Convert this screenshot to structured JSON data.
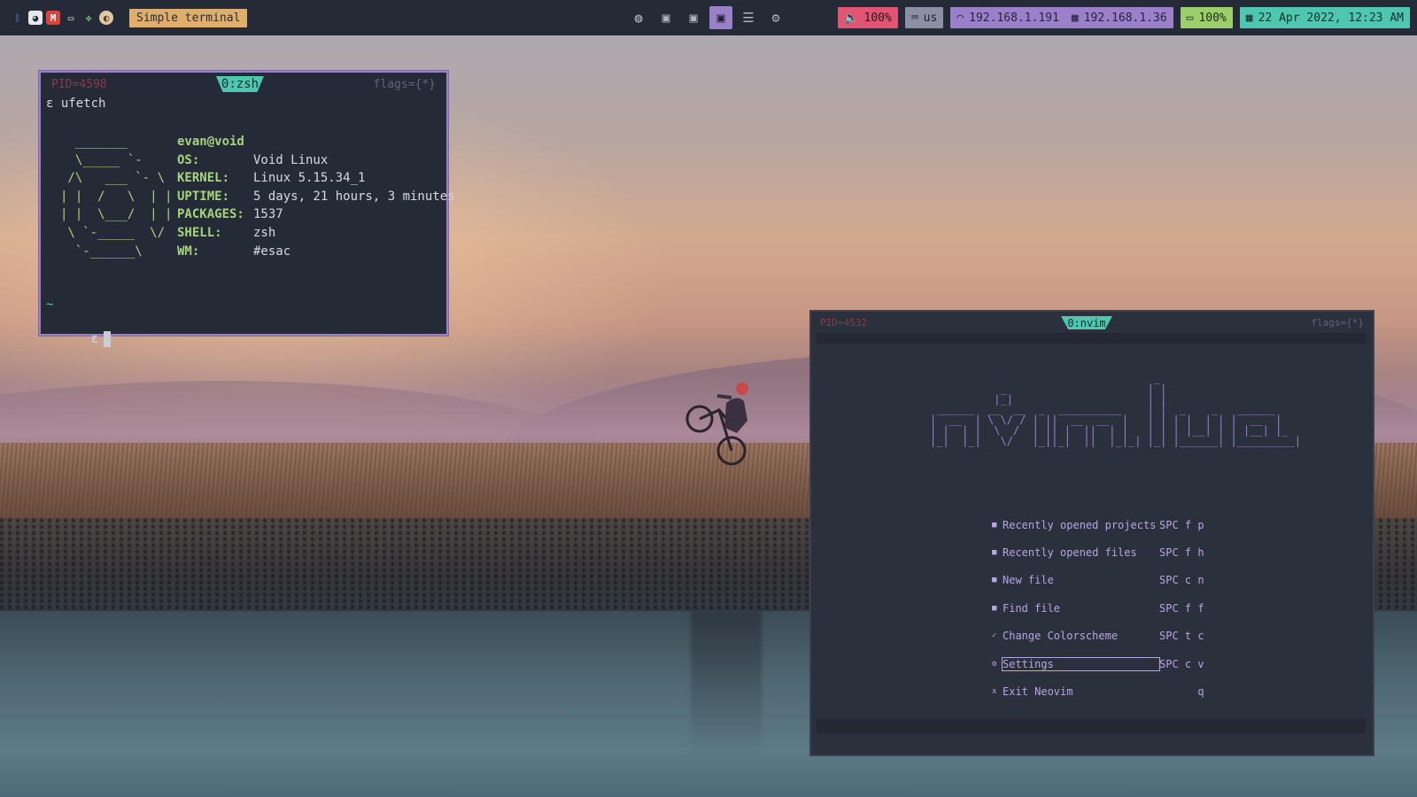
{
  "topbar": {
    "tray_icons": [
      "bluetooth-icon",
      "discord-icon",
      "gmail-icon",
      "monitor-icon",
      "puzzle-icon",
      "globe-icon"
    ],
    "window_title": "Simple terminal",
    "volume": "100%",
    "keyboard_layout": "us",
    "wifi_ip": "192.168.1.191",
    "ethernet_ip": "192.168.1.36",
    "battery": "100%",
    "datetime": "22 Apr 2022, 12:23 AM"
  },
  "term1": {
    "pid": "PID=4598",
    "tab": "0:zsh",
    "flags": "flags={*}",
    "command_line": "ε ufetch",
    "user_host": "evan@void",
    "ascii_art": "  _______\n  \\_____ `-\n /\\   ___ `- \\\n| |  /   \\  | |\n| |  \\___/  | |\n \\ `-_____  \\/\n  `-______\\",
    "info": [
      {
        "key": "OS:",
        "value": "Void Linux"
      },
      {
        "key": "KERNEL:",
        "value": "Linux 5.15.34_1"
      },
      {
        "key": "UPTIME:",
        "value": "5 days, 21 hours, 3 minutes"
      },
      {
        "key": "PACKAGES:",
        "value": "1537"
      },
      {
        "key": "SHELL:",
        "value": "zsh"
      },
      {
        "key": "WM:",
        "value": "#esac"
      }
    ],
    "tilde": "~",
    "prompt": "ε"
  },
  "term2": {
    "pid": "PID=4532",
    "tab": "0:nvim",
    "flags": "flags={*}",
    "logo": "                                   _\n           _                      | |\n          |_|                     | |\n ______  __  __  _  __________    | |  _    _   ______\n|  __  | \\ \\/ / | ||  __  __  |   | | | |  | | |  __  |\n| |  | |  \\  /  | || |  ||  | |   | | | |__| | | |__| |_\n|_|  |_|   \\/   |_||_|  ||  |_|_| |_| |______| |_________|",
    "menu": [
      {
        "icon": "■",
        "label": "Recently opened projects",
        "shortcut": "SPC f p"
      },
      {
        "icon": "■",
        "label": "Recently opened files",
        "shortcut": "SPC f h"
      },
      {
        "icon": "■",
        "label": "New file",
        "shortcut": "SPC c n"
      },
      {
        "icon": "■",
        "label": "Find file",
        "shortcut": "SPC f f"
      },
      {
        "icon": "✓",
        "label": "Change Colorscheme",
        "shortcut": "SPC t c"
      },
      {
        "icon": "⚙",
        "label": "Settings",
        "shortcut": "SPC c v"
      },
      {
        "icon": "x",
        "label": "Exit Neovim",
        "shortcut": "      q"
      }
    ]
  }
}
